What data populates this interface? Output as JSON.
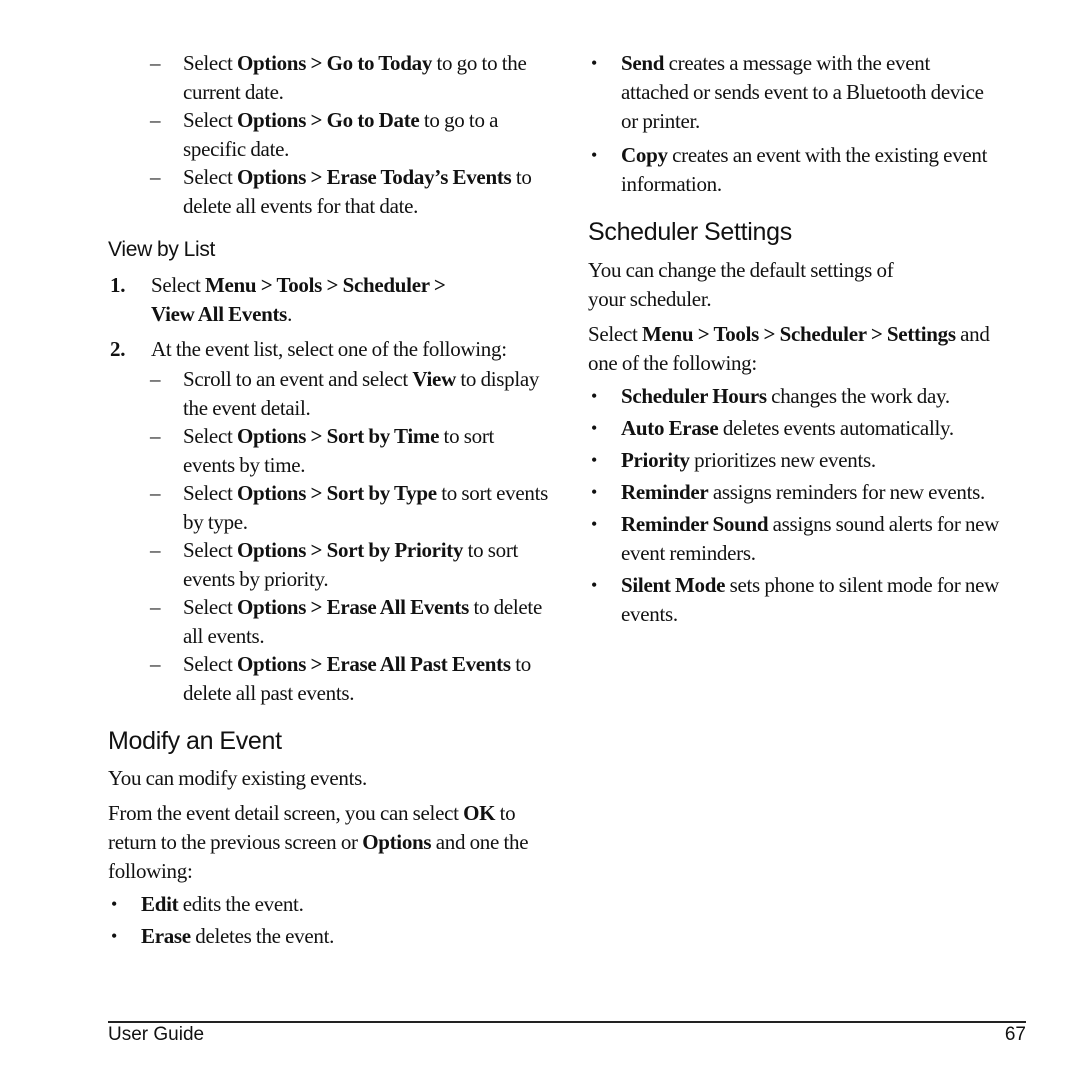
{
  "left_column": {
    "top_dash_items": [
      {
        "marker": "–",
        "pre": "Select ",
        "bold": "Options > Go to Today",
        "post": " to go to the current date."
      },
      {
        "marker": "–",
        "pre": "Select ",
        "bold": "Options > Go to Date",
        "post": " to go to a specific date."
      },
      {
        "marker": "–",
        "pre": "Select ",
        "bold": "Options > Erase Today’s Events",
        "post": " to delete all events for that date."
      }
    ],
    "view_by_list": {
      "heading": "View by List",
      "step1": {
        "number": "1.",
        "pre": "Select ",
        "bold1": "Menu > Tools > Scheduler >",
        "bold2": "View All Events",
        "post": "."
      },
      "step2": {
        "number": "2.",
        "text": "At the event list, select one of the following:"
      },
      "dash_items": [
        {
          "marker": "–",
          "pre": "Scroll to an event and select ",
          "bold": "View",
          "post": " to display the event detail."
        },
        {
          "marker": "–",
          "pre": "Select ",
          "bold": "Options > Sort by Time",
          "post": " to sort events by time."
        },
        {
          "marker": "–",
          "pre": "Select ",
          "bold": "Options > Sort by Type",
          "post": " to sort events by type."
        },
        {
          "marker": "–",
          "pre": "Select ",
          "bold": "Options > Sort by Priority",
          "post": " to sort events by priority."
        },
        {
          "marker": "–",
          "pre": "Select ",
          "bold": "Options > Erase All Events",
          "post": " to delete all events."
        },
        {
          "marker": "–",
          "pre": "Select ",
          "bold": "Options > Erase All Past Events",
          "post": " to delete all past events."
        }
      ]
    },
    "modify_event": {
      "heading": "Modify an Event",
      "intro": "You can modify existing events.",
      "para": {
        "pre": "From the event detail screen, you can select ",
        "bold1": "OK",
        "mid": " to return to the previous screen or ",
        "bold2": "Options",
        "post": " and one the following:"
      },
      "bullets": [
        {
          "marker": "•",
          "bold": "Edit",
          "post": " edits the event."
        },
        {
          "marker": "•",
          "bold": "Erase",
          "post": " deletes the event."
        }
      ]
    }
  },
  "right_column": {
    "top_bullets": [
      {
        "marker": "•",
        "bold": "Send",
        "post": " creates a message with the event attached or sends event to a Bluetooth device or printer."
      },
      {
        "marker": "•",
        "bold": "Copy",
        "post": " creates an event with the existing event information."
      }
    ],
    "scheduler_settings": {
      "heading": "Scheduler Settings",
      "intro": "You can change the default settings of your scheduler.",
      "select": {
        "pre": "Select ",
        "bold": "Menu > Tools > Scheduler > Settings",
        "post": " and one of the following:"
      },
      "bullets": [
        {
          "marker": "•",
          "bold": "Scheduler Hours",
          "post": " changes the work day."
        },
        {
          "marker": "•",
          "bold": "Auto Erase",
          "post": " deletes events automatically."
        },
        {
          "marker": "•",
          "bold": "Priority",
          "post": " prioritizes new events."
        },
        {
          "marker": "•",
          "bold": "Reminder",
          "post": " assigns reminders for new events."
        },
        {
          "marker": "•",
          "bold": "Reminder Sound",
          "post": " assigns sound alerts for new event reminders."
        },
        {
          "marker": "•",
          "bold": "Silent Mode",
          "post": " sets phone to silent mode for new events."
        }
      ]
    }
  },
  "footer": {
    "title": "User Guide",
    "page_number": "67"
  }
}
